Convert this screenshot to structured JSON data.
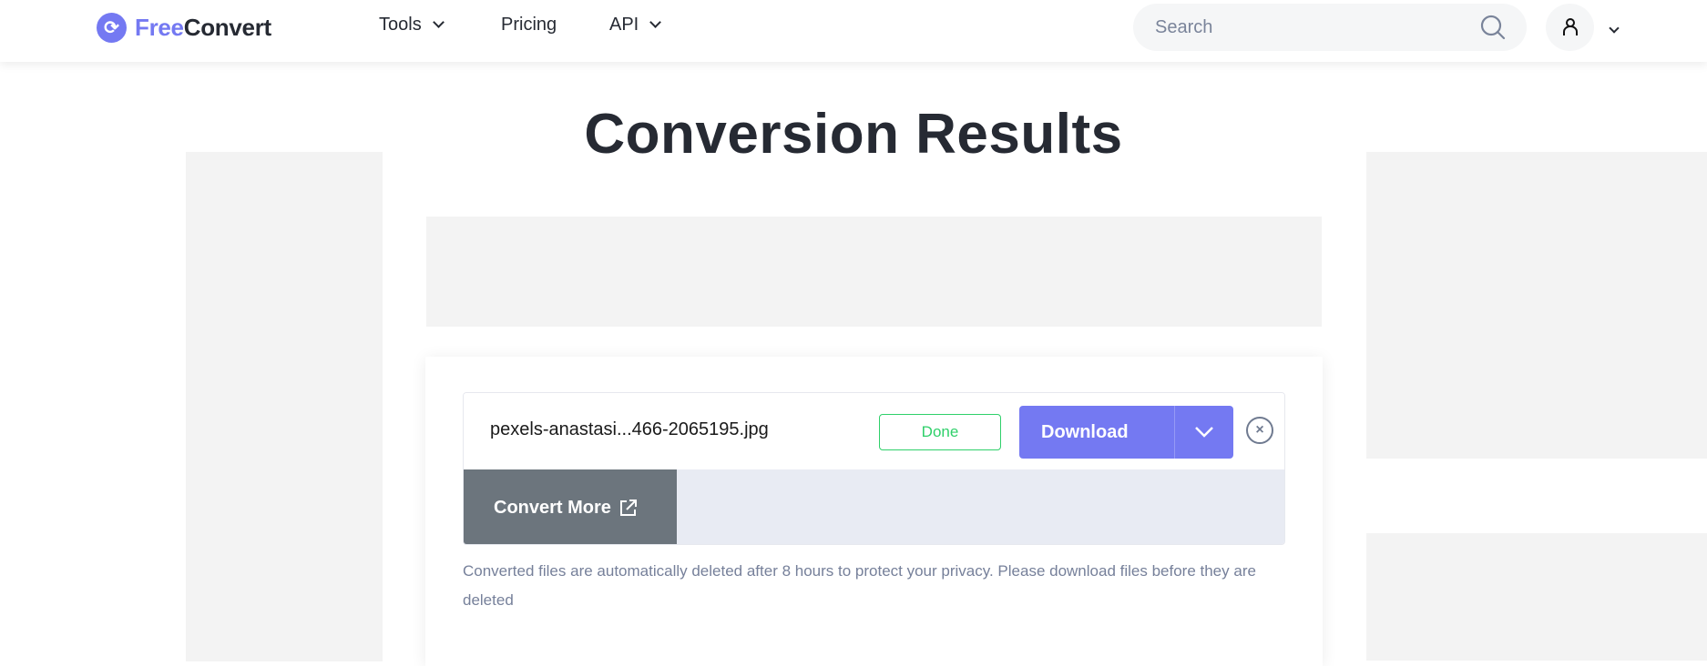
{
  "header": {
    "logo_part1": "Free",
    "logo_part2": "Convert",
    "nav": [
      {
        "label": "Tools"
      },
      {
        "label": "Pricing"
      },
      {
        "label": "API"
      }
    ],
    "search_placeholder": "Search"
  },
  "main": {
    "title": "Conversion Results",
    "file": {
      "name": "pexels-anastasi...466-2065195.jpg",
      "status": "Done",
      "download_label": "Download"
    },
    "convert_more_label": "Convert More",
    "note": "Converted files are automatically deleted after 8 hours to protect your privacy. Please download files before they are deleted"
  },
  "colors": {
    "accent": "#7479f2",
    "success": "#2fd06a",
    "convert_more_bg": "#6c757d"
  }
}
